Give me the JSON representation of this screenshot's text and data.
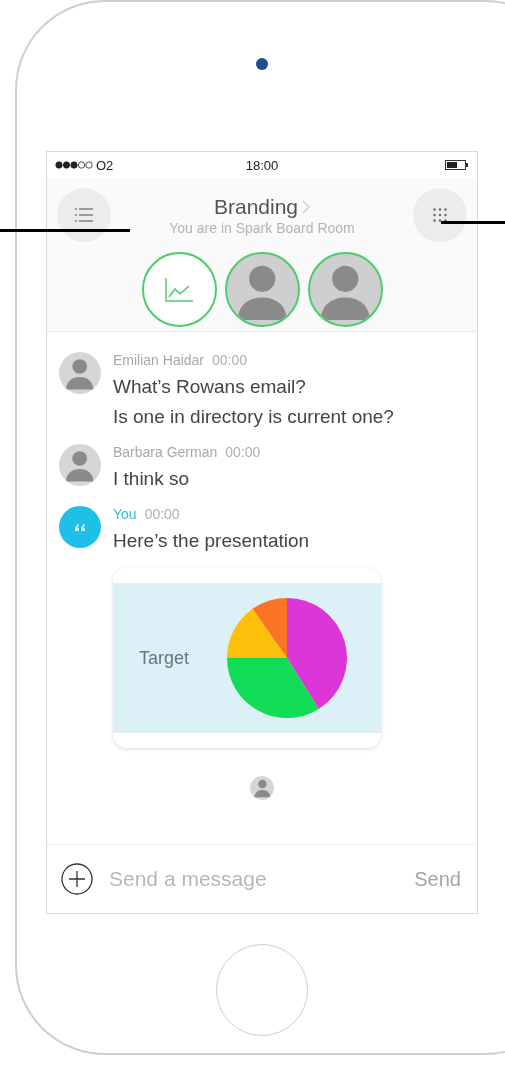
{
  "status_bar": {
    "carrier": "O2",
    "time": "18:00"
  },
  "header": {
    "title": "Branding",
    "subtitle": "You are in Spark Board Room"
  },
  "participants": [
    {
      "kind": "chart"
    },
    {
      "kind": "photo"
    },
    {
      "kind": "photo"
    }
  ],
  "messages": [
    {
      "author": "Emilian Haidar",
      "time": "00:00",
      "self": false,
      "lines": [
        "What’s Rowans email?",
        "Is one in directory is current one?"
      ]
    },
    {
      "author": "Barbara German",
      "time": "00:00",
      "self": false,
      "lines": [
        "I think so"
      ]
    },
    {
      "author": "You",
      "time": "00:00",
      "self": true,
      "lines": [
        "Here’s the presentation"
      ],
      "attachment": {
        "label": "Target"
      }
    }
  ],
  "composer": {
    "placeholder": "Send a message",
    "send": "Send"
  }
}
